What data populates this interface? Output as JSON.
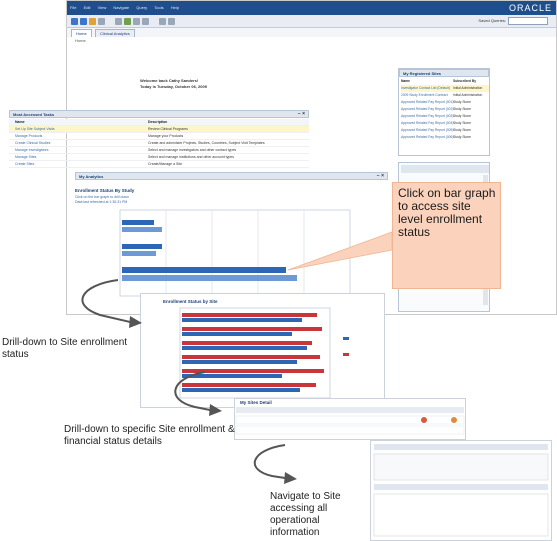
{
  "menubar": {
    "items": [
      "File",
      "Edit",
      "View",
      "Navigate",
      "Query",
      "Tools",
      "Help"
    ],
    "brand": "ORACLE"
  },
  "toolbar": {
    "search_label": "Saved Queries:"
  },
  "tabs": [
    {
      "label": "Home"
    },
    {
      "label": "Clinical Analytics"
    }
  ],
  "breadcrumb": "Home",
  "welcome": {
    "line1": "Welcome back Cathy Sanders!",
    "line2": "Today is Tuesday, October 06, 2009"
  },
  "favorites": {
    "title": "Most Accessed Tasks",
    "headers": {
      "name": "Name",
      "description": "Description"
    },
    "rows": [
      {
        "name": "Set Up Site Subject Visits",
        "description": "Review Clinical Programs"
      },
      {
        "name": "Manage Products",
        "description": "Manage your Products"
      },
      {
        "name": "Create Clinical Studies",
        "description": "Create and administer Projects, Studies, Countries, Subject Visit Templates"
      },
      {
        "name": "Manage Investigators",
        "description": "Select and manage investigators and other contact types"
      },
      {
        "name": "Manage Sites",
        "description": "Select and manage institutions and other account types"
      },
      {
        "name": "Create Sites",
        "description": "Create/Manage a Site"
      }
    ]
  },
  "analytics": {
    "title": "My Analytics"
  },
  "enrollment_chart": {
    "title": "Enrollment Status By Study",
    "sub1": "Click on the bar graph to drill down",
    "sub2": "Data last refreshed at 1:30:31 PM"
  },
  "subjects_panel": {
    "title": "My Registered Sites",
    "headers": {
      "name": "Name",
      "type": "Subscribed By"
    },
    "rows": [
      {
        "name": "Investigator Contact List (Default)",
        "type": "Initial Administration"
      },
      {
        "name": "2009 Study Enrollment Contract",
        "type": "Initial Administration"
      },
      {
        "name": "Approved Related Pay Report (001)",
        "type": "Study Stone"
      },
      {
        "name": "Approved Related Pay Report (002)",
        "type": "Study Stone"
      },
      {
        "name": "Approved Related Pay Report (003)",
        "type": "Study Stone"
      },
      {
        "name": "Approved Related Pay Report (004)",
        "type": "Study Stone"
      },
      {
        "name": "Approved Related Pay Report (005)",
        "type": "Study Stone"
      },
      {
        "name": "Approved Related Pay Report (006)",
        "type": "Study Stone"
      }
    ]
  },
  "callout": {
    "text": "Click on bar graph to access site level enrollment status"
  },
  "site_chart": {
    "title": "Enrollment Status by Site"
  },
  "detail": {
    "title": "My Sites Detail"
  },
  "annotations": {
    "a1": "Drill-down to Site enrollment status",
    "a2": "Drill-down to specific Site enrollment & financial status details",
    "a3": "Navigate to Site accessing all operational information"
  },
  "colors": {
    "brand_blue": "#1f4e8c",
    "bar_blue": "#2c67b5",
    "bar_red": "#c8353a",
    "callout": "#fbd3bd"
  }
}
